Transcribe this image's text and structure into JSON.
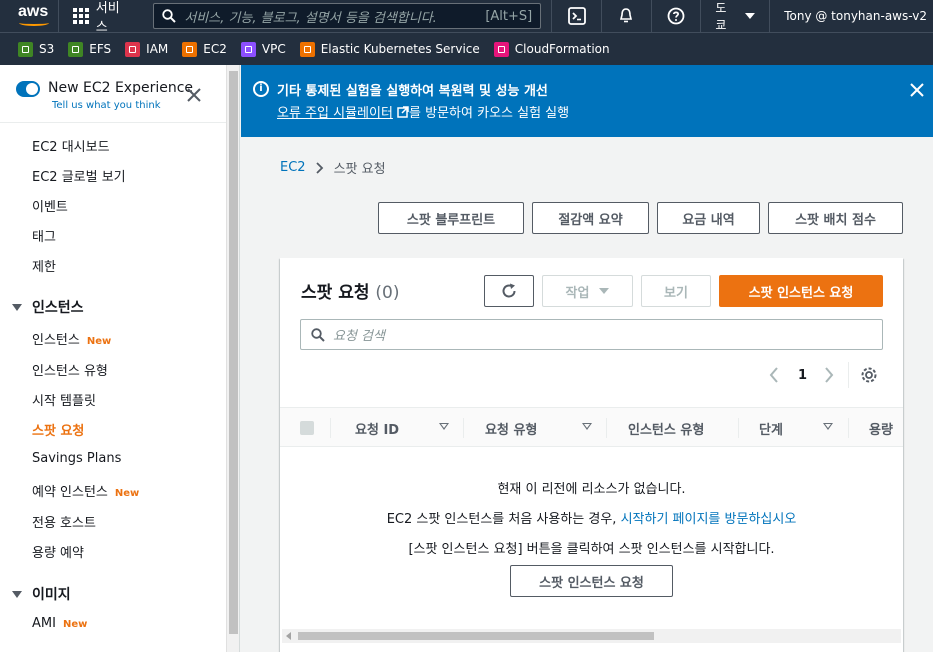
{
  "topnav": {
    "logo": "aws",
    "services": "서비스",
    "search_placeholder": "서비스, 기능, 블로그, 설명서 등을 검색합니다.",
    "search_shortcut": "[Alt+S]",
    "region": "도쿄",
    "user": "Tony @ tonyhan-aws-v2"
  },
  "favorites": [
    {
      "label": "S3",
      "color": "#3f8624"
    },
    {
      "label": "EFS",
      "color": "#3f8624"
    },
    {
      "label": "IAM",
      "color": "#dd344c"
    },
    {
      "label": "EC2",
      "color": "#ed7100"
    },
    {
      "label": "VPC",
      "color": "#8c4fff"
    },
    {
      "label": "Elastic Kubernetes Service",
      "color": "#ed7100"
    },
    {
      "label": "CloudFormation",
      "color": "#e7157b"
    }
  ],
  "sidebar": {
    "toggle_title": "New EC2 Experience",
    "toggle_sub": "Tell us what you think",
    "items": [
      {
        "label": "EC2 대시보드"
      },
      {
        "label": "EC2 글로벌 보기"
      },
      {
        "label": "이벤트"
      },
      {
        "label": "태그"
      },
      {
        "label": "제한"
      }
    ],
    "section_instances": "인스턴스",
    "instances_items": [
      {
        "label": "인스턴스",
        "badge": "New"
      },
      {
        "label": "인스턴스 유형"
      },
      {
        "label": "시작 템플릿"
      },
      {
        "label": "스팟 요청"
      },
      {
        "label": "Savings Plans"
      },
      {
        "label": "예약 인스턴스",
        "badge": "New"
      },
      {
        "label": "전용 호스트"
      },
      {
        "label": "용량 예약"
      }
    ],
    "section_images": "이미지",
    "images_items": [
      {
        "label": "AMI",
        "badge": "New"
      }
    ]
  },
  "flash": {
    "heading": "기타 통제된 실험을 실행하여 복원력 및 성능 개선",
    "link": "오류 주입 시뮬레이터",
    "rest": "를 방문하여 카오스 실험 실행"
  },
  "breadcrumb": {
    "root": "EC2",
    "current": "스팟 요청"
  },
  "top_buttons": {
    "blueprint": "스팟 블루프린트",
    "savings": "절감액 요약",
    "pricing": "요금 내역",
    "placement": "스팟 배치 점수"
  },
  "panel": {
    "title": "스팟 요청",
    "count": "(0)",
    "actions": "작업",
    "view": "보기",
    "request": "스팟 인스턴스 요청",
    "search_placeholder": "요청 검색",
    "page": "1",
    "columns": [
      "요청 ID",
      "요청 유형",
      "인스턴스 유형",
      "단계",
      "용량"
    ],
    "empty_line1": "현재 이 리전에 리소스가 없습니다.",
    "empty_line2_pre": "EC2 스팟 인스턴스를 처음 사용하는 경우, ",
    "empty_line2_link": "시작하기 페이지를 방문하십시오",
    "empty_line3": "[스팟 인스턴스 요청] 버튼을 클릭하여 스팟 인스턴스를 시작합니다.",
    "empty_button": "스팟 인스턴스 요청"
  }
}
